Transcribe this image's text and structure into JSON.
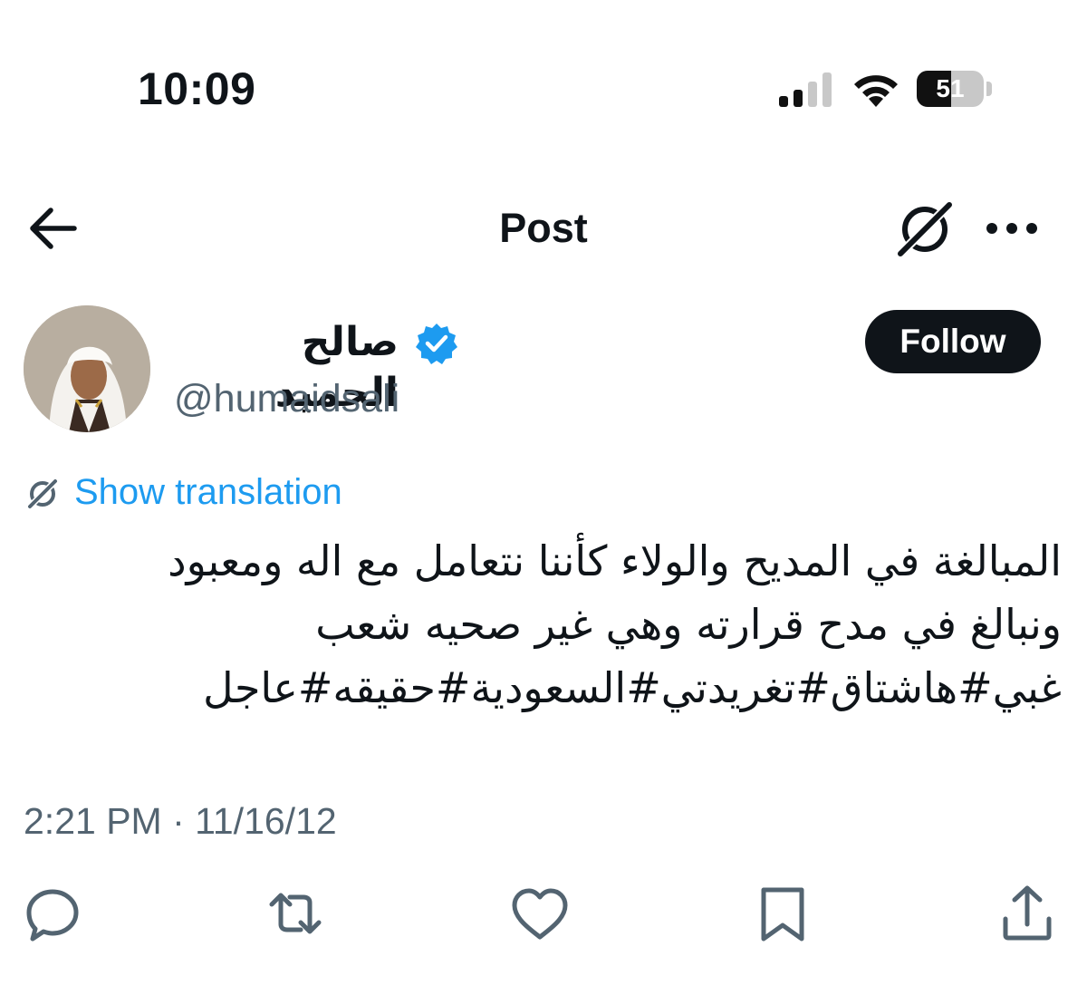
{
  "status_bar": {
    "time": "10:09",
    "battery_percent": "51",
    "battery_level": 0.51,
    "icons": [
      "signal-icon",
      "wifi-icon",
      "battery-icon"
    ]
  },
  "nav": {
    "title": "Post",
    "icons": [
      "back-arrow-icon",
      "grok-icon",
      "more-icon"
    ]
  },
  "author": {
    "display_name": "صالح الحميد",
    "handle": "@humaidsali",
    "verified": true,
    "verified_color": "#1d9bf0",
    "follow_label": "Follow"
  },
  "translation": {
    "label": "Show translation",
    "color": "#1d9bf0"
  },
  "tweet": {
    "text": "المبالغة في المديح والولاء كأننا نتعامل مع اله ومعبود\nونبالغ في مدح قرارته وهي غير صحيه شعب\nغبي#هاشتاق#تغريدتي#السعودية#حقيقه#عاجل"
  },
  "timestamp": "2:21 PM · 11/16/12",
  "actions": [
    "reply-icon",
    "repost-icon",
    "like-icon",
    "bookmark-icon",
    "share-icon"
  ]
}
